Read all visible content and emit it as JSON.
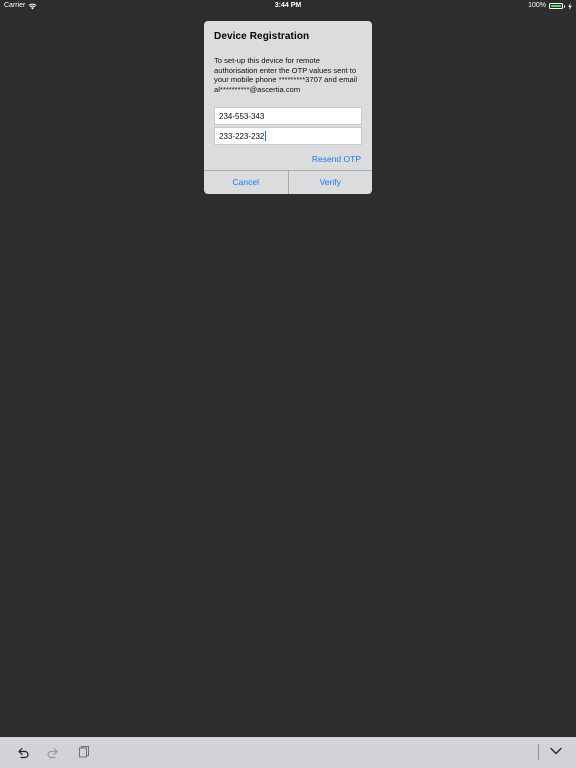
{
  "status_bar": {
    "carrier": "Carrier",
    "time": "3:44 PM",
    "battery_percent": "100%",
    "battery_level": 1.0
  },
  "dialog": {
    "title": "Device Registration",
    "message": "To set-up this device for remote authorisation enter the OTP values sent to your mobile phone *********3707 and email al**********@ascertia.com",
    "otp_field_1": "234-553-343",
    "otp_field_2": "233-223-232",
    "resend_label": "Resend OTP",
    "cancel_label": "Cancel",
    "verify_label": "Verify"
  },
  "colors": {
    "background": "#2d2d2d",
    "dialog_bg": "#dbdcdd",
    "accent": "#1d7bf0",
    "battery": "#4cd964",
    "toolbar_bg": "#d2d3d6"
  },
  "toolbar": {
    "icons": [
      "undo-icon",
      "redo-icon",
      "paste-icon",
      "chevron-down-icon"
    ]
  }
}
